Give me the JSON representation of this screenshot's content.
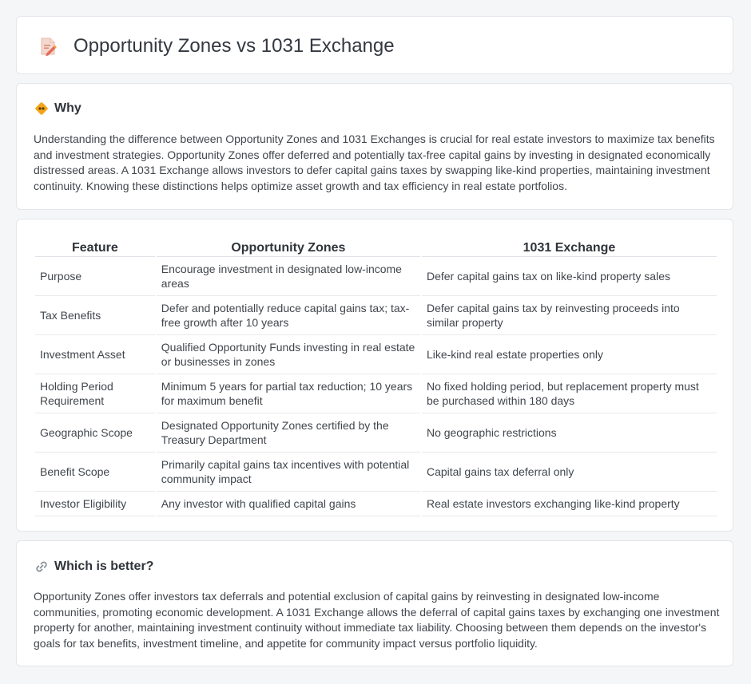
{
  "page": {
    "title": "Opportunity Zones vs 1031 Exchange",
    "title_icon": "document-pencil-icon"
  },
  "why": {
    "icon": "diamond-sign-icon",
    "heading": "Why",
    "text": "Understanding the difference between Opportunity Zones and 1031 Exchanges is crucial for real estate investors to maximize tax benefits and investment strategies. Opportunity Zones offer deferred and potentially tax-free capital gains by investing in designated economically distressed areas. A 1031 Exchange allows investors to defer capital gains taxes by swapping like-kind properties, maintaining investment continuity. Knowing these distinctions helps optimize asset growth and tax efficiency in real estate portfolios."
  },
  "comparison": {
    "headers": [
      "Feature",
      "Opportunity Zones",
      "1031 Exchange"
    ],
    "rows": [
      [
        "Purpose",
        "Encourage investment in designated low-income areas",
        "Defer capital gains tax on like-kind property sales"
      ],
      [
        "Tax Benefits",
        "Defer and potentially reduce capital gains tax; tax-free growth after 10 years",
        "Defer capital gains tax by reinvesting proceeds into similar property"
      ],
      [
        "Investment Asset",
        "Qualified Opportunity Funds investing in real estate or businesses in zones",
        "Like-kind real estate properties only"
      ],
      [
        "Holding Period Requirement",
        "Minimum 5 years for partial tax reduction; 10 years for maximum benefit",
        "No fixed holding period, but replacement property must be purchased within 180 days"
      ],
      [
        "Geographic Scope",
        "Designated Opportunity Zones certified by the Treasury Department",
        "No geographic restrictions"
      ],
      [
        "Benefit Scope",
        "Primarily capital gains tax incentives with potential community impact",
        "Capital gains tax deferral only"
      ],
      [
        "Investor Eligibility",
        "Any investor with qualified capital gains",
        "Real estate investors exchanging like-kind property"
      ]
    ]
  },
  "better": {
    "icon": "link-icon",
    "heading": "Which is better?",
    "text": "Opportunity Zones offer investors tax deferrals and potential exclusion of capital gains by reinvesting in designated low-income communities, promoting economic development. A 1031 Exchange allows the deferral of capital gains taxes by exchanging one investment property for another, maintaining investment continuity without immediate tax liability. Choosing between them depends on the investor's goals for tax benefits, investment timeline, and appetite for community impact versus portfolio liquidity."
  }
}
